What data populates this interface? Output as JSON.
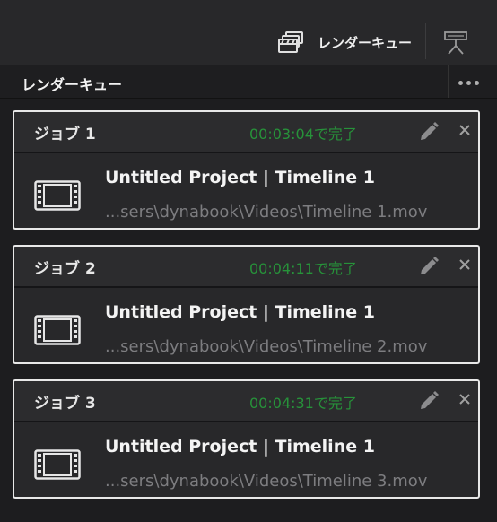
{
  "topbar": {
    "render_queue_label": "レンダーキュー"
  },
  "panel": {
    "title": "レンダーキュー"
  },
  "jobs": [
    {
      "title": "ジョブ 1",
      "status": "00:03:04で完了",
      "name": "Untitled Project | Timeline 1",
      "path": "...sers\\dynabook\\Videos\\Timeline 1.mov"
    },
    {
      "title": "ジョブ 2",
      "status": "00:04:11で完了",
      "name": "Untitled Project | Timeline 1",
      "path": "...sers\\dynabook\\Videos\\Timeline 2.mov"
    },
    {
      "title": "ジョブ 3",
      "status": "00:04:31で完了",
      "name": "Untitled Project | Timeline 1",
      "path": "...sers\\dynabook\\Videos\\Timeline 3.mov"
    }
  ],
  "colors": {
    "status_complete": "#27923a",
    "job_border": "#e8e8e8"
  },
  "icons": {
    "queue": "clapperboard-stack-icon",
    "monitor": "monitor-icon",
    "more": "more-dots-icon",
    "edit": "pencil-icon",
    "close": "close-icon",
    "clip": "film-icon"
  }
}
